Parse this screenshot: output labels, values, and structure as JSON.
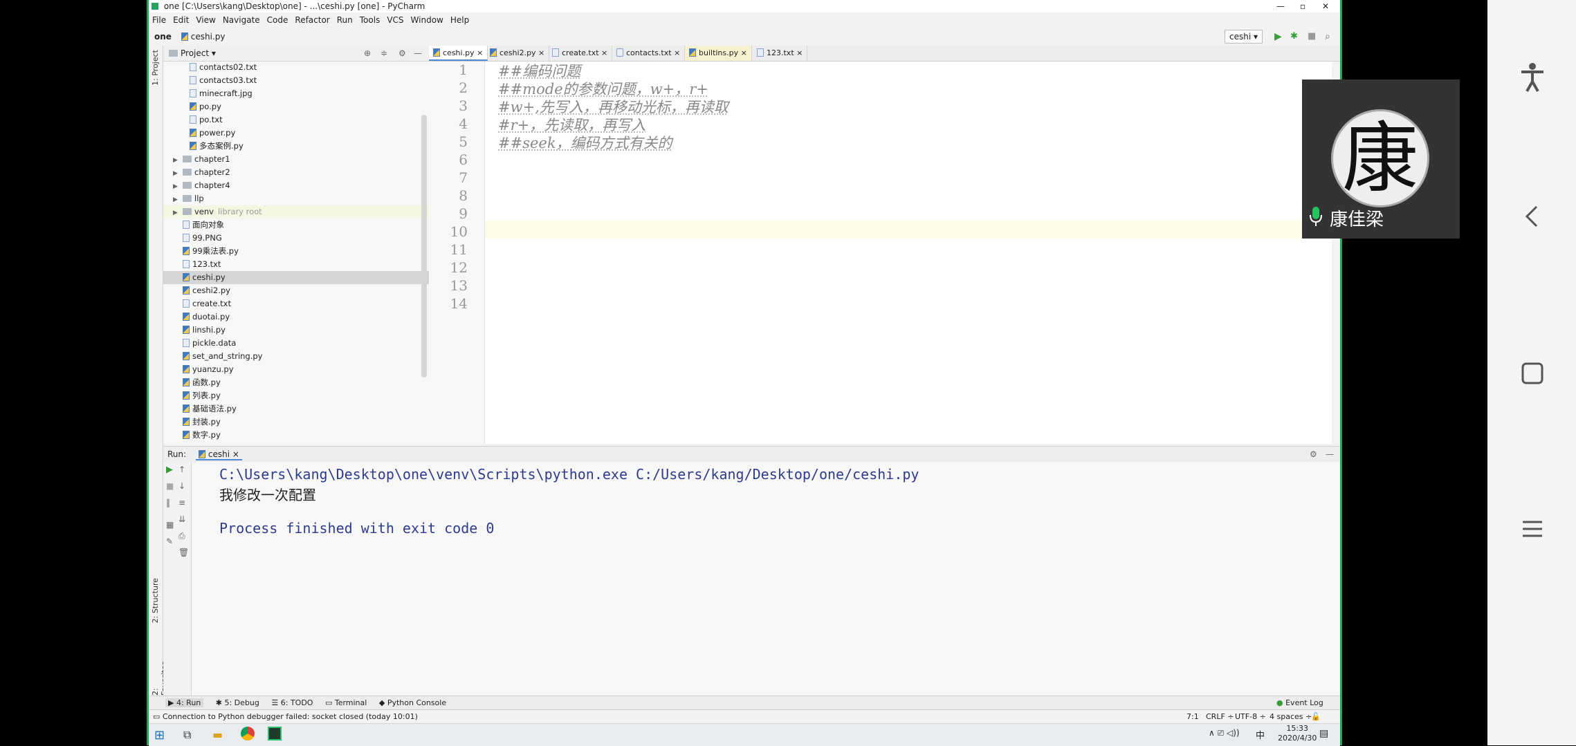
{
  "window": {
    "title": "one [C:\\Users\\kang\\Desktop\\one] - ...\\ceshi.py [one] - PyCharm"
  },
  "menu": [
    "File",
    "Edit",
    "View",
    "Navigate",
    "Code",
    "Refactor",
    "Run",
    "Tools",
    "VCS",
    "Window",
    "Help"
  ],
  "nav": {
    "project": "one",
    "file": "ceshi.py",
    "run_config": "ceshi"
  },
  "side_strip": {
    "project": "1: Project",
    "structure": "2: Structure",
    "favorites": "2: Favorites"
  },
  "project_panel": {
    "title": "Project"
  },
  "tree": [
    {
      "label": "contacts02.txt",
      "type": "txt"
    },
    {
      "label": "contacts03.txt",
      "type": "txt"
    },
    {
      "label": "minecraft.jpg",
      "type": "img"
    },
    {
      "label": "po.py",
      "type": "py"
    },
    {
      "label": "po.txt",
      "type": "txt"
    },
    {
      "label": "power.py",
      "type": "py"
    },
    {
      "label": "多态案例.py",
      "type": "py"
    },
    {
      "label": "chapter1",
      "type": "folder"
    },
    {
      "label": "chapter2",
      "type": "folder"
    },
    {
      "label": "chapter4",
      "type": "folder"
    },
    {
      "label": "llp",
      "type": "folder"
    },
    {
      "label": "venv",
      "type": "folder",
      "note": "library root"
    },
    {
      "label": "面向对象",
      "type": "txt"
    },
    {
      "label": "99.PNG",
      "type": "img"
    },
    {
      "label": "99乘法表.py",
      "type": "py"
    },
    {
      "label": "123.txt",
      "type": "txt"
    },
    {
      "label": "ceshi.py",
      "type": "py",
      "selected": true
    },
    {
      "label": "ceshi2.py",
      "type": "py"
    },
    {
      "label": "create.txt",
      "type": "txt"
    },
    {
      "label": "duotai.py",
      "type": "py"
    },
    {
      "label": "linshi.py",
      "type": "py"
    },
    {
      "label": "pickle.data",
      "type": "txt"
    },
    {
      "label": "set_and_string.py",
      "type": "py"
    },
    {
      "label": "yuanzu.py",
      "type": "py"
    },
    {
      "label": "函数.py",
      "type": "py"
    },
    {
      "label": "列表.py",
      "type": "py"
    },
    {
      "label": "基础语法.py",
      "type": "py"
    },
    {
      "label": "封装.py",
      "type": "py"
    },
    {
      "label": "数字.py",
      "type": "py"
    }
  ],
  "tabs": [
    "ceshi.py",
    "ceshi2.py",
    "create.txt",
    "contacts.txt",
    "builtins.py",
    "123.txt"
  ],
  "editor": {
    "line_numbers": [
      "1",
      "2",
      "3",
      "4",
      "5",
      "6",
      "7",
      "8",
      "9",
      "10",
      "11",
      "12",
      "13",
      "14"
    ],
    "lines": [
      "##编码问题",
      "##mode的参数问题，w+，r+",
      "#w+,先写入，再移动光标，再读取",
      "#r+，先读取，再写入",
      "##seek，编码方式有关的"
    ]
  },
  "run": {
    "label": "Run:",
    "tab": "ceshi",
    "output": [
      "C:\\Users\\kang\\Desktop\\one\\venv\\Scripts\\python.exe C:/Users/kang/Desktop/one/ceshi.py",
      "我修改一次配置",
      "",
      "Process finished with exit code 0"
    ]
  },
  "tool_windows": [
    "4: Run",
    "5: Debug",
    "6: TODO",
    "Terminal",
    "Python Console"
  ],
  "event_log": "Event Log",
  "status": {
    "message": "Connection to Python debugger failed: socket closed (today 10:01)",
    "position": "7:1",
    "line_sep": "CRLF",
    "encoding": "UTF-8",
    "indent": "4 spaces"
  },
  "taskbar": {
    "ime": "中",
    "time": "15:33",
    "date": "2020/4/30"
  },
  "video": {
    "name": "康佳梁",
    "avatar_char": "康"
  },
  "colors": {
    "accent_green": "#1ea855",
    "console_blue": "#2f3a8c",
    "comment_gray": "#888888"
  }
}
